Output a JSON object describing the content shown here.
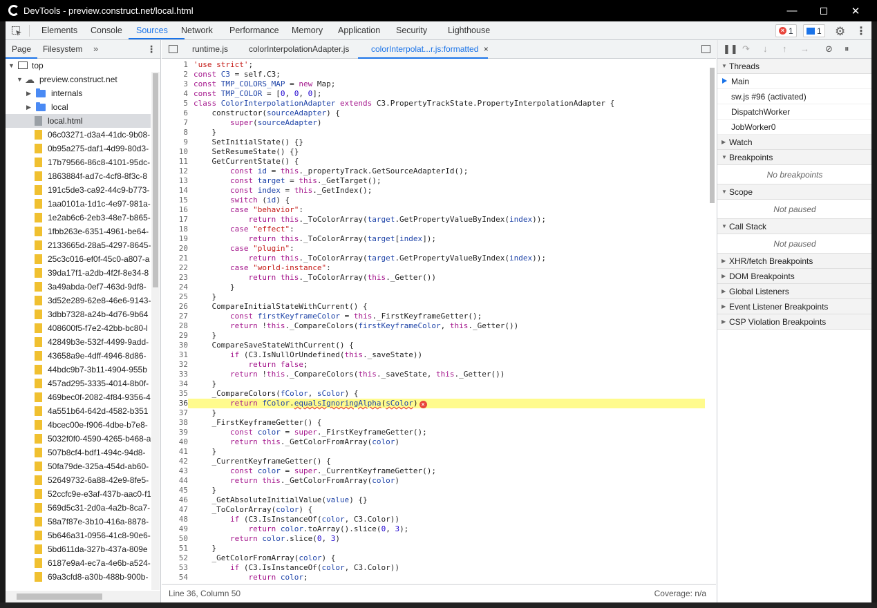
{
  "window": {
    "title": "DevTools - preview.construct.net/local.html"
  },
  "main_tabs": [
    "Elements",
    "Console",
    "Sources",
    "Network",
    "Performance",
    "Memory",
    "Application",
    "Security",
    "Lighthouse"
  ],
  "badges": {
    "errors": "1",
    "messages": "1"
  },
  "navigator": {
    "tabs": [
      "Page",
      "Filesystem"
    ],
    "more": "»",
    "tree": [
      {
        "label": "top",
        "type": "frame",
        "expanded": true
      },
      {
        "label": "preview.construct.net",
        "type": "cloud",
        "expanded": true
      },
      {
        "label": "internals",
        "type": "folder",
        "expanded": false
      },
      {
        "label": "local",
        "type": "folder",
        "expanded": false
      },
      {
        "label": "local.html",
        "type": "html",
        "selected": true
      },
      {
        "label": "06c03271-d3a4-41dc-9b08-",
        "type": "file"
      },
      {
        "label": "0b95a275-daf1-4d99-80d3-",
        "type": "file"
      },
      {
        "label": "17b79566-86c8-4101-95dc-",
        "type": "file"
      },
      {
        "label": "1863884f-ad7c-4cf8-8f3c-8",
        "type": "file"
      },
      {
        "label": "191c5de3-ca92-44c9-b773-",
        "type": "file"
      },
      {
        "label": "1aa0101a-1d1c-4e97-981a-",
        "type": "file"
      },
      {
        "label": "1e2ab6c6-2eb3-48e7-b865-",
        "type": "file"
      },
      {
        "label": "1fbb263e-6351-4961-be64-",
        "type": "file"
      },
      {
        "label": "2133665d-28a5-4297-8645-",
        "type": "file"
      },
      {
        "label": "25c3c016-ef0f-45c0-a807-a",
        "type": "file"
      },
      {
        "label": "39da17f1-a2db-4f2f-8e34-8",
        "type": "file"
      },
      {
        "label": "3a49abda-0ef7-463d-9df8-",
        "type": "file"
      },
      {
        "label": "3d52e289-62e8-46e6-9143-",
        "type": "file"
      },
      {
        "label": "3dbb7328-a24b-4d76-9b64",
        "type": "file"
      },
      {
        "label": "408600f5-f7e2-42bb-bc80-l",
        "type": "file"
      },
      {
        "label": "42849b3e-532f-4499-9add-",
        "type": "file"
      },
      {
        "label": "43658a9e-4dff-4946-8d86-",
        "type": "file"
      },
      {
        "label": "44bdc9b7-3b11-4904-955b",
        "type": "file"
      },
      {
        "label": "457ad295-3335-4014-8b0f-",
        "type": "file"
      },
      {
        "label": "469bec0f-2082-4f84-9356-4",
        "type": "file"
      },
      {
        "label": "4a551b64-642d-4582-b351",
        "type": "file"
      },
      {
        "label": "4bcec00e-f906-4dbe-b7e8-",
        "type": "file"
      },
      {
        "label": "5032f0f0-4590-4265-b468-a",
        "type": "file"
      },
      {
        "label": "507b8cf4-bdf1-494c-94d8-",
        "type": "file"
      },
      {
        "label": "50fa79de-325a-454d-ab60-",
        "type": "file"
      },
      {
        "label": "52649732-6a88-42e9-8fe5-",
        "type": "file"
      },
      {
        "label": "52ccfc9e-e3af-437b-aac0-f1",
        "type": "file"
      },
      {
        "label": "569d5c31-2d0a-4a2b-8ca7-",
        "type": "file"
      },
      {
        "label": "58a7f87e-3b10-416a-8878-",
        "type": "file"
      },
      {
        "label": "5b646a31-0956-41c8-90e6-",
        "type": "file"
      },
      {
        "label": "5bd611da-327b-437a-809e",
        "type": "file"
      },
      {
        "label": "6187e9a4-ec7a-4e6b-a524-",
        "type": "file"
      },
      {
        "label": "69a3cfd8-a30b-488b-900b-",
        "type": "file"
      }
    ]
  },
  "editor": {
    "tabs": [
      "runtime.js",
      "colorInterpolationAdapter.js",
      "colorInterpolat...r.js:formatted"
    ],
    "close": "×",
    "highlight_line": 36,
    "lines": [
      [
        [
          "s",
          "'use strict'"
        ],
        [
          "p",
          ";"
        ]
      ],
      [
        [
          "k",
          "const "
        ],
        [
          "v",
          "C3"
        ],
        [
          "p",
          " = self.C3;"
        ]
      ],
      [
        [
          "k",
          "const "
        ],
        [
          "v",
          "TMP_COLORS_MAP"
        ],
        [
          "p",
          " = "
        ],
        [
          "k",
          "new "
        ],
        [
          "p",
          "Map;"
        ]
      ],
      [
        [
          "k",
          "const "
        ],
        [
          "v",
          "TMP_COLOR"
        ],
        [
          "p",
          " = ["
        ],
        [
          "n",
          "0"
        ],
        [
          "p",
          ", "
        ],
        [
          "n",
          "0"
        ],
        [
          "p",
          ", "
        ],
        [
          "n",
          "0"
        ],
        [
          "p",
          "];"
        ]
      ],
      [
        [
          "k",
          "class "
        ],
        [
          "v",
          "ColorInterpolationAdapter "
        ],
        [
          "k",
          "extends "
        ],
        [
          "p",
          "C3.PropertyTrackState.PropertyInterpolationAdapter {"
        ]
      ],
      [
        [
          "p",
          "    constructor("
        ],
        [
          "v",
          "sourceAdapter"
        ],
        [
          "p",
          ") {"
        ]
      ],
      [
        [
          "p",
          "        "
        ],
        [
          "k",
          "super"
        ],
        [
          "p",
          "("
        ],
        [
          "v",
          "sourceAdapter"
        ],
        [
          "p",
          ")"
        ]
      ],
      [
        [
          "p",
          "    }"
        ]
      ],
      [
        [
          "p",
          "    SetInitialState() {}"
        ]
      ],
      [
        [
          "p",
          "    SetResumeState() {}"
        ]
      ],
      [
        [
          "p",
          "    GetCurrentState() {"
        ]
      ],
      [
        [
          "p",
          "        "
        ],
        [
          "k",
          "const "
        ],
        [
          "v",
          "id"
        ],
        [
          "p",
          " = "
        ],
        [
          "k",
          "this"
        ],
        [
          "p",
          "._propertyTrack.GetSourceAdapterId();"
        ]
      ],
      [
        [
          "p",
          "        "
        ],
        [
          "k",
          "const "
        ],
        [
          "v",
          "target"
        ],
        [
          "p",
          " = "
        ],
        [
          "k",
          "this"
        ],
        [
          "p",
          "._GetTarget();"
        ]
      ],
      [
        [
          "p",
          "        "
        ],
        [
          "k",
          "const "
        ],
        [
          "v",
          "index"
        ],
        [
          "p",
          " = "
        ],
        [
          "k",
          "this"
        ],
        [
          "p",
          "._GetIndex();"
        ]
      ],
      [
        [
          "p",
          "        "
        ],
        [
          "k",
          "switch "
        ],
        [
          "p",
          "("
        ],
        [
          "v",
          "id"
        ],
        [
          "p",
          ") {"
        ]
      ],
      [
        [
          "p",
          "        "
        ],
        [
          "k",
          "case "
        ],
        [
          "s",
          "\"behavior\""
        ],
        [
          "p",
          ":"
        ]
      ],
      [
        [
          "p",
          "            "
        ],
        [
          "k",
          "return this"
        ],
        [
          "p",
          "._ToColorArray("
        ],
        [
          "v",
          "target"
        ],
        [
          "p",
          ".GetPropertyValueByIndex("
        ],
        [
          "v",
          "index"
        ],
        [
          "p",
          "));"
        ]
      ],
      [
        [
          "p",
          "        "
        ],
        [
          "k",
          "case "
        ],
        [
          "s",
          "\"effect\""
        ],
        [
          "p",
          ":"
        ]
      ],
      [
        [
          "p",
          "            "
        ],
        [
          "k",
          "return this"
        ],
        [
          "p",
          "._ToColorArray("
        ],
        [
          "v",
          "target"
        ],
        [
          "p",
          "["
        ],
        [
          "v",
          "index"
        ],
        [
          "p",
          "]);"
        ]
      ],
      [
        [
          "p",
          "        "
        ],
        [
          "k",
          "case "
        ],
        [
          "s",
          "\"plugin\""
        ],
        [
          "p",
          ":"
        ]
      ],
      [
        [
          "p",
          "            "
        ],
        [
          "k",
          "return this"
        ],
        [
          "p",
          "._ToColorArray("
        ],
        [
          "v",
          "target"
        ],
        [
          "p",
          ".GetPropertyValueByIndex("
        ],
        [
          "v",
          "index"
        ],
        [
          "p",
          "));"
        ]
      ],
      [
        [
          "p",
          "        "
        ],
        [
          "k",
          "case "
        ],
        [
          "s",
          "\"world-instance\""
        ],
        [
          "p",
          ":"
        ]
      ],
      [
        [
          "p",
          "            "
        ],
        [
          "k",
          "return this"
        ],
        [
          "p",
          "._ToColorArray("
        ],
        [
          "k",
          "this"
        ],
        [
          "p",
          "._Getter())"
        ]
      ],
      [
        [
          "p",
          "        }"
        ]
      ],
      [
        [
          "p",
          "    }"
        ]
      ],
      [
        [
          "p",
          "    CompareInitialStateWithCurrent() {"
        ]
      ],
      [
        [
          "p",
          "        "
        ],
        [
          "k",
          "const "
        ],
        [
          "v",
          "firstKeyframeColor"
        ],
        [
          "p",
          " = "
        ],
        [
          "k",
          "this"
        ],
        [
          "p",
          "._FirstKeyframeGetter();"
        ]
      ],
      [
        [
          "p",
          "        "
        ],
        [
          "k",
          "return "
        ],
        [
          "p",
          "!"
        ],
        [
          "k",
          "this"
        ],
        [
          "p",
          "._CompareColors("
        ],
        [
          "v",
          "firstKeyframeColor"
        ],
        [
          "p",
          ", "
        ],
        [
          "k",
          "this"
        ],
        [
          "p",
          "._Getter())"
        ]
      ],
      [
        [
          "p",
          "    }"
        ]
      ],
      [
        [
          "p",
          "    CompareSaveStateWithCurrent() {"
        ]
      ],
      [
        [
          "p",
          "        "
        ],
        [
          "k",
          "if "
        ],
        [
          "p",
          "(C3.IsNullOrUndefined("
        ],
        [
          "k",
          "this"
        ],
        [
          "p",
          "._saveState))"
        ]
      ],
      [
        [
          "p",
          "            "
        ],
        [
          "k",
          "return false"
        ],
        [
          "p",
          ";"
        ]
      ],
      [
        [
          "p",
          "        "
        ],
        [
          "k",
          "return "
        ],
        [
          "p",
          "!"
        ],
        [
          "k",
          "this"
        ],
        [
          "p",
          "._CompareColors("
        ],
        [
          "k",
          "this"
        ],
        [
          "p",
          "._saveState, "
        ],
        [
          "k",
          "this"
        ],
        [
          "p",
          "._Getter())"
        ]
      ],
      [
        [
          "p",
          "    }"
        ]
      ],
      [
        [
          "p",
          "    _CompareColors("
        ],
        [
          "v",
          "fColor"
        ],
        [
          "p",
          ", "
        ],
        [
          "v",
          "sColor"
        ],
        [
          "p",
          ") {"
        ]
      ],
      [
        [
          "p",
          "        "
        ],
        [
          "k",
          "return "
        ],
        [
          "v",
          "fColor"
        ],
        [
          "p",
          "."
        ],
        [
          "w",
          "equalsIgnoringAlpha"
        ],
        [
          "p",
          "("
        ],
        [
          "w",
          "sColor"
        ],
        [
          "p",
          ")"
        ],
        [
          "e",
          "x"
        ]
      ],
      [
        [
          "p",
          "    }"
        ]
      ],
      [
        [
          "p",
          "    _FirstKeyframeGetter() {"
        ]
      ],
      [
        [
          "p",
          "        "
        ],
        [
          "k",
          "const "
        ],
        [
          "v",
          "color"
        ],
        [
          "p",
          " = "
        ],
        [
          "k",
          "super"
        ],
        [
          "p",
          "._FirstKeyframeGetter();"
        ]
      ],
      [
        [
          "p",
          "        "
        ],
        [
          "k",
          "return this"
        ],
        [
          "p",
          "._GetColorFromArray("
        ],
        [
          "v",
          "color"
        ],
        [
          "p",
          ")"
        ]
      ],
      [
        [
          "p",
          "    }"
        ]
      ],
      [
        [
          "p",
          "    _CurrentKeyframeGetter() {"
        ]
      ],
      [
        [
          "p",
          "        "
        ],
        [
          "k",
          "const "
        ],
        [
          "v",
          "color"
        ],
        [
          "p",
          " = "
        ],
        [
          "k",
          "super"
        ],
        [
          "p",
          "._CurrentKeyframeGetter();"
        ]
      ],
      [
        [
          "p",
          "        "
        ],
        [
          "k",
          "return this"
        ],
        [
          "p",
          "._GetColorFromArray("
        ],
        [
          "v",
          "color"
        ],
        [
          "p",
          ")"
        ]
      ],
      [
        [
          "p",
          "    }"
        ]
      ],
      [
        [
          "p",
          "    _GetAbsoluteInitialValue("
        ],
        [
          "v",
          "value"
        ],
        [
          "p",
          ") {}"
        ]
      ],
      [
        [
          "p",
          "    _ToColorArray("
        ],
        [
          "v",
          "color"
        ],
        [
          "p",
          ") {"
        ]
      ],
      [
        [
          "p",
          "        "
        ],
        [
          "k",
          "if "
        ],
        [
          "p",
          "(C3.IsInstanceOf("
        ],
        [
          "v",
          "color"
        ],
        [
          "p",
          ", C3.Color))"
        ]
      ],
      [
        [
          "p",
          "            "
        ],
        [
          "k",
          "return "
        ],
        [
          "v",
          "color"
        ],
        [
          "p",
          ".toArray().slice("
        ],
        [
          "n",
          "0"
        ],
        [
          "p",
          ", "
        ],
        [
          "n",
          "3"
        ],
        [
          "p",
          ");"
        ]
      ],
      [
        [
          "p",
          "        "
        ],
        [
          "k",
          "return "
        ],
        [
          "v",
          "color"
        ],
        [
          "p",
          ".slice("
        ],
        [
          "n",
          "0"
        ],
        [
          "p",
          ", "
        ],
        [
          "n",
          "3"
        ],
        [
          "p",
          ")"
        ]
      ],
      [
        [
          "p",
          "    }"
        ]
      ],
      [
        [
          "p",
          "    _GetColorFromArray("
        ],
        [
          "v",
          "color"
        ],
        [
          "p",
          ") {"
        ]
      ],
      [
        [
          "p",
          "        "
        ],
        [
          "k",
          "if "
        ],
        [
          "p",
          "(C3.IsInstanceOf("
        ],
        [
          "v",
          "color"
        ],
        [
          "p",
          ", C3.Color))"
        ]
      ],
      [
        [
          "p",
          "            "
        ],
        [
          "k",
          "return "
        ],
        [
          "v",
          "color"
        ],
        [
          "p",
          ";"
        ]
      ]
    ],
    "status": {
      "position": "Line 36, Column 50",
      "coverage": "Coverage: n/a"
    }
  },
  "debugger": {
    "sections": [
      {
        "title": "Threads",
        "expanded": true,
        "rows": [
          {
            "label": "Main",
            "current": true
          },
          {
            "label": "sw.js #96 (activated)"
          },
          {
            "label": "DispatchWorker"
          },
          {
            "label": "JobWorker0"
          }
        ]
      },
      {
        "title": "Watch",
        "expanded": false
      },
      {
        "title": "Breakpoints",
        "expanded": true,
        "empty": "No breakpoints"
      },
      {
        "title": "Scope",
        "expanded": true,
        "empty": "Not paused"
      },
      {
        "title": "Call Stack",
        "expanded": true,
        "empty": "Not paused"
      },
      {
        "title": "XHR/fetch Breakpoints",
        "expanded": false
      },
      {
        "title": "DOM Breakpoints",
        "expanded": false
      },
      {
        "title": "Global Listeners",
        "expanded": false
      },
      {
        "title": "Event Listener Breakpoints",
        "expanded": false
      },
      {
        "title": "CSP Violation Breakpoints",
        "expanded": false
      }
    ]
  }
}
